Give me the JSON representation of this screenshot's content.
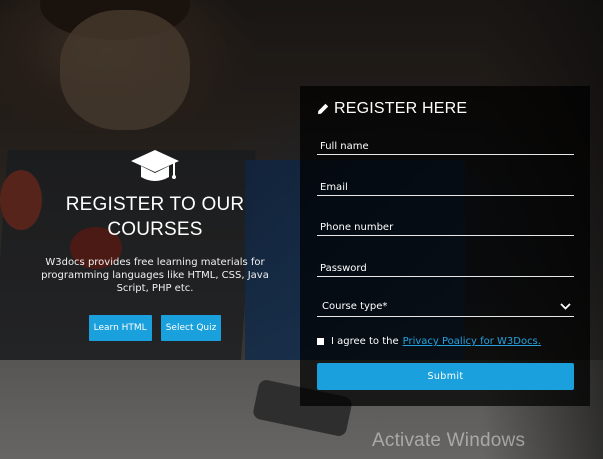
{
  "promo": {
    "title": "REGISTER TO OUR COURSES",
    "description": "W3docs provides free learning materials for programming languages like HTML, CSS, Java Script, PHP etc.",
    "buttons": [
      "Learn HTML",
      "Select Quiz"
    ],
    "icon": "graduation-cap-icon"
  },
  "form": {
    "title": "REGISTER HERE",
    "title_icon": "pencil-icon",
    "fields": [
      {
        "placeholder": "Full name"
      },
      {
        "placeholder": "Email"
      },
      {
        "placeholder": "Phone number"
      },
      {
        "placeholder": "Password"
      }
    ],
    "course_select": {
      "label": "Course type*",
      "icon": "chevron-down-icon"
    },
    "agree": {
      "text": "I agree to the",
      "link": "Privacy Poalicy for W3Docs."
    },
    "submit_label": "Submit"
  },
  "watermark": "Activate Windows",
  "colors": {
    "accent": "#1aa0dc",
    "link": "#25a3e0",
    "panel_bg": "rgba(0,0,0,0.72)"
  }
}
